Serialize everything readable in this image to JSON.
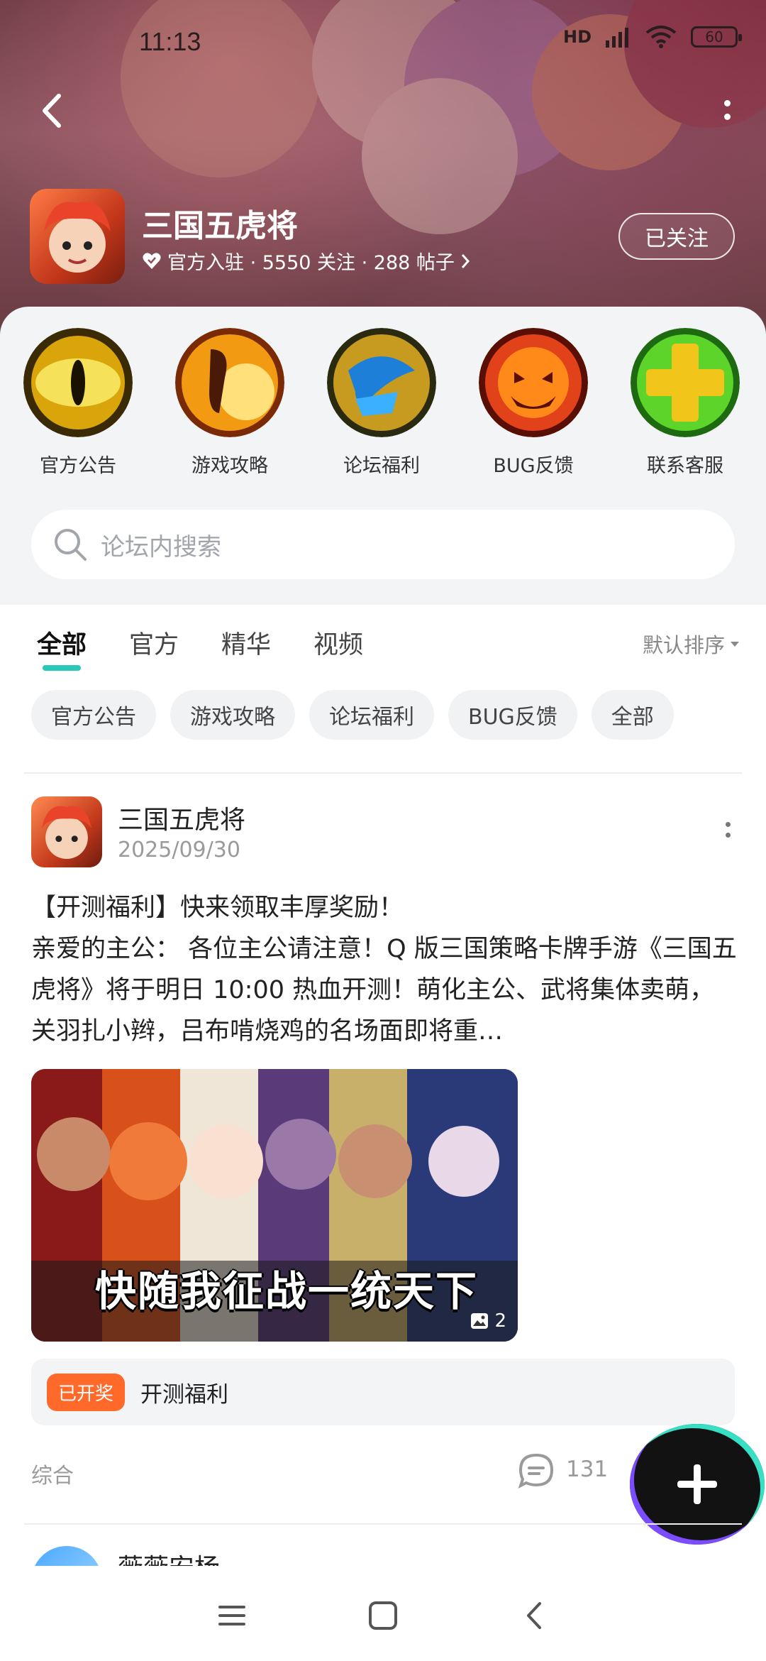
{
  "status_bar": {
    "time": "11:13",
    "network": "HD",
    "battery": "60"
  },
  "forum": {
    "title": "三国五虎将",
    "meta_text": "官方入驻 · 5550 关注 · 288 帖子",
    "follow_label": "已关注"
  },
  "quick_links": [
    {
      "label": "官方公告"
    },
    {
      "label": "游戏攻略"
    },
    {
      "label": "论坛福利"
    },
    {
      "label": "BUG反馈"
    },
    {
      "label": "联系客服"
    }
  ],
  "search": {
    "placeholder": "论坛内搜索"
  },
  "tabs": [
    {
      "label": "全部",
      "active": true
    },
    {
      "label": "官方"
    },
    {
      "label": "精华"
    },
    {
      "label": "视频"
    }
  ],
  "sort_label": "默认排序",
  "chips": [
    "官方公告",
    "游戏攻略",
    "论坛福利",
    "BUG反馈",
    "全部"
  ],
  "post": {
    "author": "三国五虎将",
    "date": "2025/09/30",
    "title": "【开测福利】快来领取丰厚奖励！",
    "body": "亲爱的主公： 各位主公请注意！Q 版三国策略卡牌手游《三国五虎将》将于明日 10:00 热血开测！萌化主公、武将集体卖萌，关羽扎小辫，吕布啃烧鸡的名场面即将重…",
    "image_caption": "快随我征战一统天下",
    "image_count": "2",
    "lottery_badge": "已开奖",
    "lottery_text": "开测福利",
    "category": "综合",
    "comment_count": "131"
  },
  "next_post": {
    "author": "薇薇安杨"
  },
  "colors": {
    "accent": "#2cc9b8",
    "lottery": "#ff6a2b"
  }
}
